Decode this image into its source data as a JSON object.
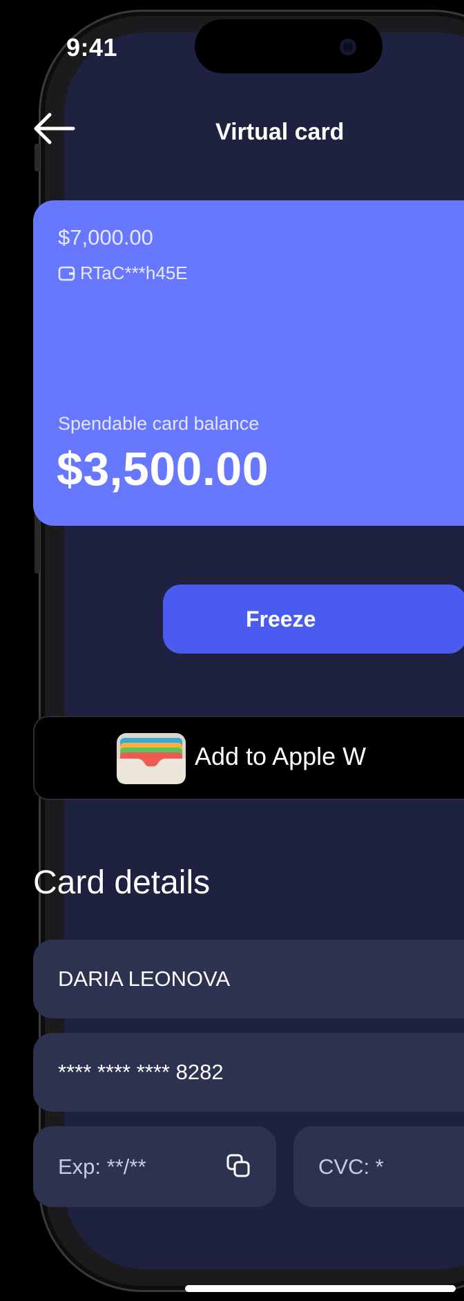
{
  "status_bar": {
    "time": "9:41"
  },
  "nav": {
    "title": "Virtual card",
    "back_icon": "arrow-left-icon"
  },
  "card": {
    "limit": "$7,000.00",
    "wallet_id": "RTaC***h45E",
    "wallet_icon": "wallet-icon",
    "balance_label": "Spendable card balance",
    "balance": "$3,500.00",
    "color": "#6878fe"
  },
  "freeze_button": {
    "label": "Freeze",
    "color": "#4a5cf0"
  },
  "apple_wallet_button": {
    "label": "Add to Apple W",
    "icon": "apple-wallet-icon"
  },
  "card_details": {
    "title": "Card details",
    "cardholder": "DARIA LEONOVA",
    "number": "**** **** **** 8282",
    "expiry": "Exp:  **/**",
    "cvc": "CVC:  *",
    "copy_icon": "copy-icon"
  },
  "theme": {
    "background": "#1e2140",
    "field_background": "#2e3251"
  }
}
